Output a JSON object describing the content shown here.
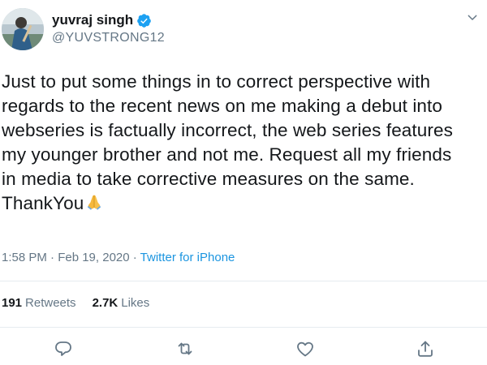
{
  "user": {
    "display_name": "yuvraj singh",
    "handle": "@YUVSTRONG12",
    "verified": true
  },
  "tweet": {
    "lines": [
      "Just to put some things in to correct perspective with",
      "regards to the recent news on me making a debut into",
      "webseries is factually incorrect, the web series features",
      "my younger brother and not me. Request all my friends",
      "in media to take corrective measures on the same.",
      "ThankYou"
    ],
    "emoji": "folded-hands",
    "timestamp": "1:58 PM · Feb 19, 2020 · ",
    "source": "Twitter for iPhone"
  },
  "stats": {
    "retweets_count": "191",
    "retweets_label": "Retweets",
    "likes_count": "2.7K",
    "likes_label": "Likes"
  },
  "icons": {
    "reply": "reply-icon",
    "retweet": "retweet-icon",
    "like": "heart-icon",
    "share": "share-icon",
    "more": "chevron-down-icon"
  },
  "colors": {
    "accent": "#1b95e0",
    "verified": "#1da1f2",
    "text": "#14171a",
    "muted": "#657786",
    "divider": "#e6ecf0"
  }
}
